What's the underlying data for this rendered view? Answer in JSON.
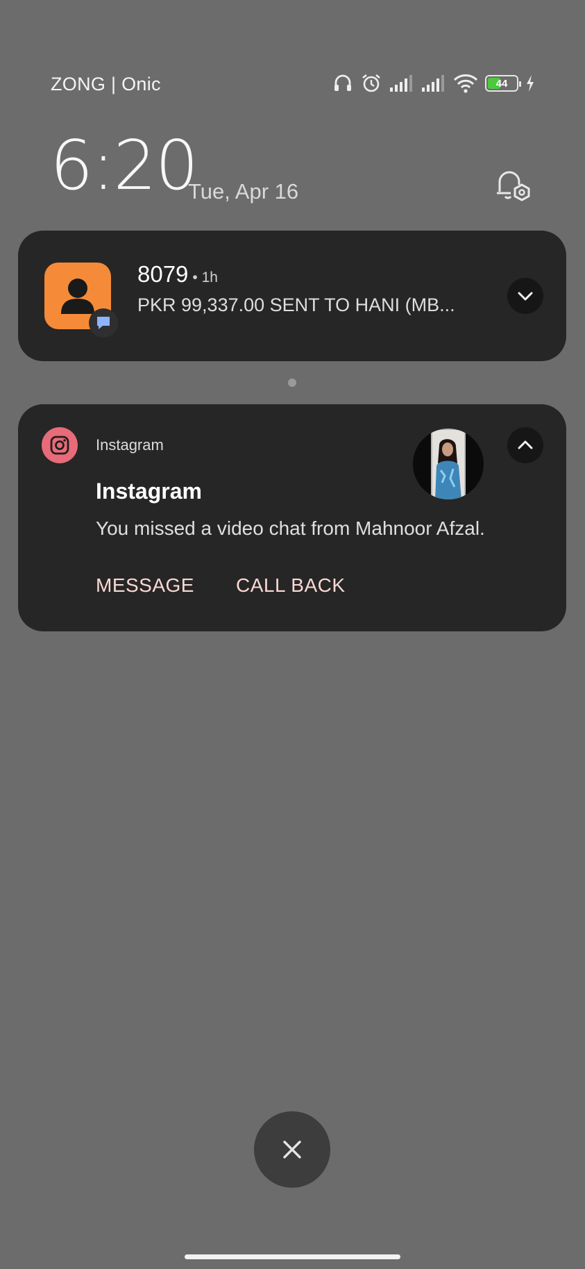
{
  "status_bar": {
    "carrier": "ZONG | Onic",
    "icons": [
      "headset-icon",
      "alarm-icon",
      "signal-sim1-icon",
      "signal-sim2-icon",
      "wifi-icon",
      "battery-icon",
      "charging-icon"
    ],
    "battery_level": "44",
    "battery_color": "#4cc93c"
  },
  "lockscreen": {
    "time": "6:20",
    "date": "Tue, Apr 16",
    "settings_icon": "notification-settings-icon"
  },
  "notifications": [
    {
      "app_icon": "contact-icon",
      "badge_icon": "message-bubble-icon",
      "sender": "8079",
      "time": "• 1h",
      "preview": "PKR 99,337.00 SENT TO HANI (MB...",
      "toggle_icon": "chevron-down-icon"
    },
    {
      "app_icon": "instagram-icon",
      "app_name": "Instagram",
      "title": "Instagram",
      "body": "You missed a video chat from Mahnoor Afzal.",
      "toggle_icon": "chevron-up-icon",
      "actions": [
        "MESSAGE",
        "CALL BACK"
      ]
    }
  ],
  "controls": {
    "dismiss_icon": "close-icon"
  },
  "colors": {
    "background": "#6c6c6c",
    "card": "#262626",
    "sms_app_tile": "#f58b38",
    "instagram_accent": "#e86b79",
    "action_text": "#fad9d4"
  }
}
